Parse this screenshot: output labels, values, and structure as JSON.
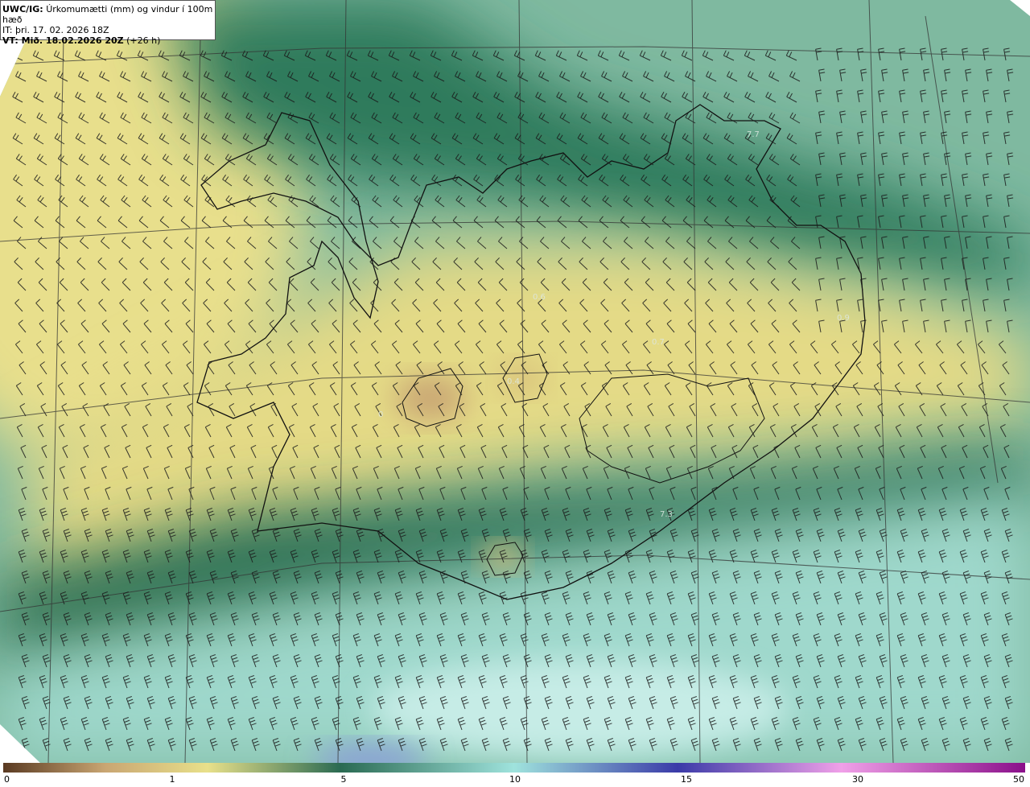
{
  "header": {
    "model": "UWC/IG:",
    "title": "Úrkomumætti (mm) og vindur í 100m hæð",
    "it_line": "IT: þri. 17. 02. 2026 18Z",
    "vt_label": "VT: Mið. 18.02.2026 20Z",
    "vt_lead": "(+26 h)"
  },
  "map_values": [
    "7.7",
    "0.6",
    "0.9",
    "0.4",
    "0.7",
    "0",
    "7.3"
  ],
  "legend": {
    "ticks": [
      "0",
      "1",
      "5",
      "10",
      "15",
      "30",
      "50"
    ],
    "colors": [
      "#5a3a22",
      "#c9a673",
      "#e8e08a",
      "#2a6a52",
      "#9fe3dd",
      "#3a3aa8",
      "#f0a0e8",
      "#8a108a"
    ]
  }
}
